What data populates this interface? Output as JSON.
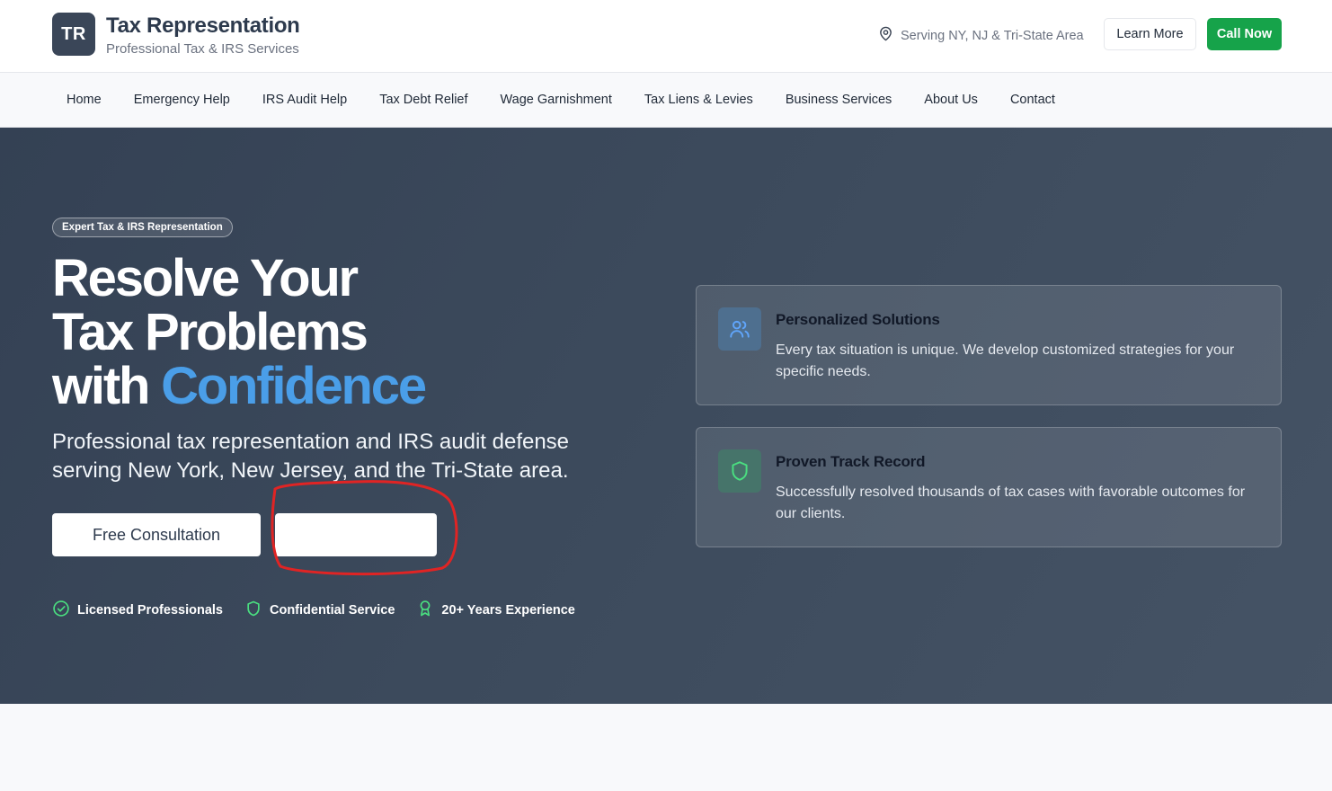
{
  "header": {
    "logo_initials": "TR",
    "brand_name": "Tax Representation",
    "brand_subtitle": "Professional Tax & IRS Services",
    "location_text": "Serving NY, NJ & Tri-State Area",
    "learn_more_label": "Learn More",
    "call_now_label": "Call Now"
  },
  "nav": {
    "items": [
      {
        "label": "Home"
      },
      {
        "label": "Emergency Help"
      },
      {
        "label": "IRS Audit Help"
      },
      {
        "label": "Tax Debt Relief"
      },
      {
        "label": "Wage Garnishment"
      },
      {
        "label": "Tax Liens & Levies"
      },
      {
        "label": "Business Services"
      },
      {
        "label": "About Us"
      },
      {
        "label": "Contact"
      }
    ]
  },
  "hero": {
    "badge": "Expert Tax & IRS Representation",
    "headline_line1": "Resolve Your",
    "headline_line2": "Tax Problems",
    "headline_line3_prefix": "with ",
    "headline_accent": "Confidence",
    "lead": "Professional tax representation and IRS audit defense serving New York, New Jersey, and the Tri-State area.",
    "primary_cta": "Free Consultation",
    "secondary_cta": "",
    "trust_items": [
      {
        "label": "Licensed Professionals",
        "icon": "check-circle-icon"
      },
      {
        "label": "Confidential Service",
        "icon": "shield-icon"
      },
      {
        "label": "20+ Years Experience",
        "icon": "award-icon"
      }
    ],
    "cards": [
      {
        "title": "Personalized Solutions",
        "description": "Every tax situation is unique. We develop customized strategies for your specific needs.",
        "icon": "users-icon"
      },
      {
        "title": "Proven Track Record",
        "description": "Successfully resolved thousands of tax cases with favorable outcomes for our clients.",
        "icon": "shield-icon"
      }
    ]
  },
  "colors": {
    "brand_dark": "#3a4658",
    "call_green": "#16a34a",
    "accent_blue": "#4a9ee8",
    "trust_green": "#4ade80",
    "annotation_red": "#e02424"
  }
}
